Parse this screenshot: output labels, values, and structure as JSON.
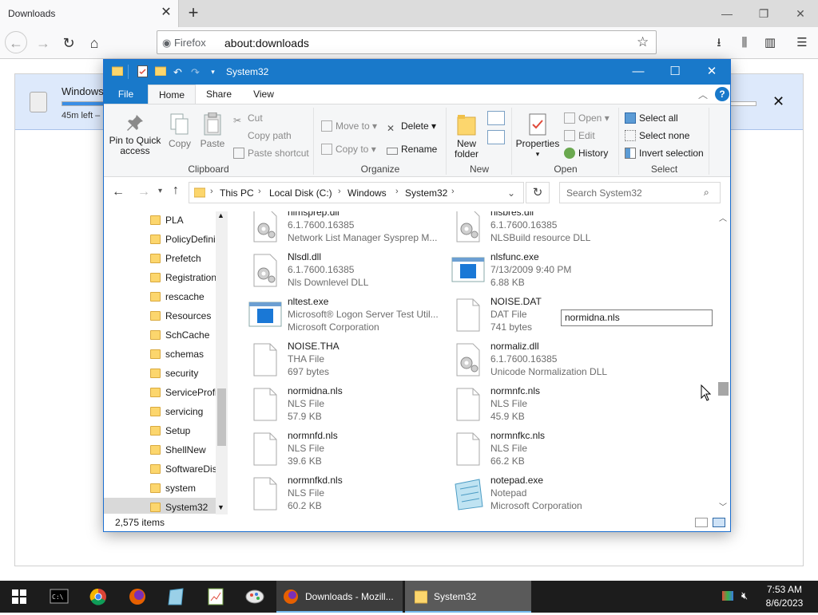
{
  "firefox": {
    "tab_title": "Downloads",
    "identity_label": "Firefox",
    "url": "about:downloads",
    "download": {
      "name": "Windows_",
      "status": "45m left –",
      "progress": 0.08
    }
  },
  "explorer": {
    "title": "System32",
    "tabs": {
      "file": "File",
      "home": "Home",
      "share": "Share",
      "view": "View"
    },
    "ribbon": {
      "clipboard": {
        "label": "Clipboard",
        "pin": "Pin to Quick access",
        "copy": "Copy",
        "paste": "Paste",
        "cut": "Cut",
        "copy_path": "Copy path",
        "paste_shortcut": "Paste shortcut"
      },
      "organize": {
        "label": "Organize",
        "move_to": "Move to",
        "copy_to": "Copy to",
        "delete": "Delete",
        "rename": "Rename"
      },
      "new": {
        "label": "New",
        "new_folder": "New folder"
      },
      "open": {
        "label": "Open",
        "properties": "Properties",
        "open": "Open",
        "edit": "Edit",
        "history": "History"
      },
      "select": {
        "label": "Select",
        "select_all": "Select all",
        "select_none": "Select none",
        "invert": "Invert selection"
      }
    },
    "breadcrumb": [
      "This PC",
      "Local Disk (C:)",
      "Windows",
      "System32"
    ],
    "search_placeholder": "Search System32",
    "tree": [
      "PLA",
      "PolicyDefini",
      "Prefetch",
      "Registration",
      "rescache",
      "Resources",
      "SchCache",
      "schemas",
      "security",
      "ServiceProfi",
      "servicing",
      "Setup",
      "ShellNew",
      "SoftwareDis",
      "system",
      "System32"
    ],
    "files_left": [
      {
        "name": "nlmsprep.dll",
        "l2": "6.1.7600.16385",
        "l3": "Network List Manager Sysprep M...",
        "icon": "dll"
      },
      {
        "name": "Nlsdl.dll",
        "l2": "6.1.7600.16385",
        "l3": "Nls Downlevel DLL",
        "icon": "dll"
      },
      {
        "name": "nltest.exe",
        "l2": "Microsoft® Logon Server Test Util...",
        "l3": "Microsoft Corporation",
        "icon": "exe"
      },
      {
        "name": "NOISE.THA",
        "l2": "THA File",
        "l3": "697 bytes",
        "icon": "file"
      },
      {
        "name": "normidna.nls",
        "l2": "NLS File",
        "l3": "57.9 KB",
        "icon": "file"
      },
      {
        "name": "normnfd.nls",
        "l2": "NLS File",
        "l3": "39.6 KB",
        "icon": "file"
      },
      {
        "name": "normnfkd.nls",
        "l2": "NLS File",
        "l3": "60.2 KB",
        "icon": "file"
      }
    ],
    "files_right": [
      {
        "name": "nlsbres.dll",
        "l2": "6.1.7600.16385",
        "l3": "NLSBuild resource DLL",
        "icon": "dll"
      },
      {
        "name": "nlsfunc.exe",
        "l2": "7/13/2009 9:40 PM",
        "l3": "6.88 KB",
        "icon": "exe"
      },
      {
        "name": "NOISE.DAT",
        "l2": "DAT File",
        "l3": "741 bytes",
        "icon": "file"
      },
      {
        "name": "normaliz.dll",
        "l2": "6.1.7600.16385",
        "l3": "Unicode Normalization DLL",
        "icon": "dll"
      },
      {
        "name": "normnfc.nls",
        "l2": "NLS File",
        "l3": "45.9 KB",
        "icon": "file"
      },
      {
        "name": "normnfkc.nls",
        "l2": "NLS File",
        "l3": "66.2 KB",
        "icon": "file"
      },
      {
        "name": "notepad.exe",
        "l2": "Notepad",
        "l3": "Microsoft Corporation",
        "icon": "notepad"
      }
    ],
    "rename_value": "normidna.nls",
    "status": "2,575 items"
  },
  "taskbar": {
    "firefox_task": "Downloads - Mozill...",
    "explorer_task": "System32",
    "time": "7:53 AM",
    "date": "8/6/2023"
  }
}
